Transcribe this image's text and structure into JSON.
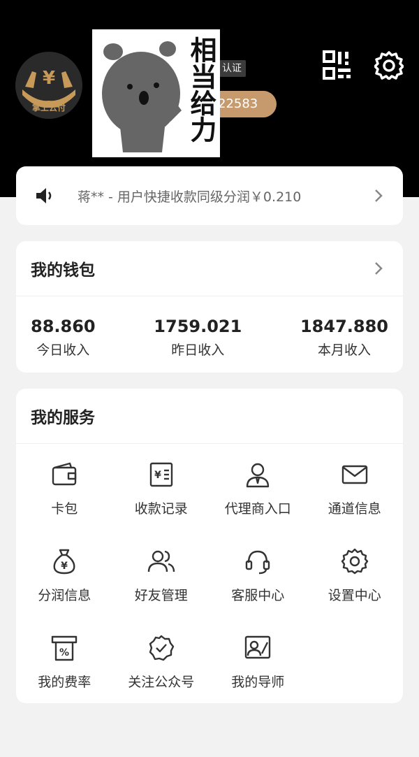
{
  "profile": {
    "avatar_label": "掌上云付",
    "sticker_text": "相当给力",
    "verify_badge": "认证",
    "user_id_fragment": "22583"
  },
  "notice": {
    "text": "蒋** - 用户快捷收款同级分润￥0.210"
  },
  "wallet": {
    "title": "我的钱包",
    "stats": [
      {
        "value": "88.860",
        "label": "今日收入"
      },
      {
        "value": "1759.021",
        "label": "昨日收入"
      },
      {
        "value": "1847.880",
        "label": "本月收入"
      }
    ]
  },
  "services": {
    "title": "我的服务",
    "items": [
      {
        "label": "卡包",
        "icon": "wallet-icon"
      },
      {
        "label": "收款记录",
        "icon": "receipt-icon"
      },
      {
        "label": "代理商入口",
        "icon": "agent-icon"
      },
      {
        "label": "通道信息",
        "icon": "mail-icon"
      },
      {
        "label": "分润信息",
        "icon": "money-bag-icon"
      },
      {
        "label": "好友管理",
        "icon": "friends-icon"
      },
      {
        "label": "客服中心",
        "icon": "headset-icon"
      },
      {
        "label": "设置中心",
        "icon": "gear-icon"
      },
      {
        "label": "我的费率",
        "icon": "rate-icon"
      },
      {
        "label": "关注公众号",
        "icon": "badge-check-icon"
      },
      {
        "label": "我的导师",
        "icon": "mentor-icon"
      }
    ]
  },
  "colors": {
    "header_bg": "#000000",
    "accent": "#c79a6d",
    "page_bg": "#f2f2f2"
  }
}
